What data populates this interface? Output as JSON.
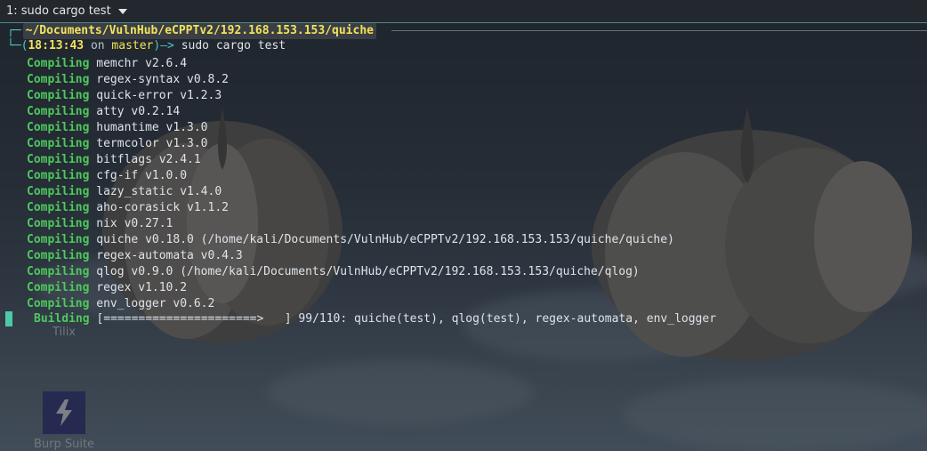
{
  "window": {
    "tab_title": "1: sudo cargo test"
  },
  "desktop": {
    "icons": [
      {
        "name": "Tilix"
      },
      {
        "name": "Burp Suite"
      }
    ]
  },
  "terminal": {
    "cwd": "~/Documents/VulnHub/eCPPTv2/192.168.153.153/quiche",
    "time": "18:13:43",
    "on_word": "on",
    "branch": "master",
    "arrow": "—>",
    "command": "sudo cargo test",
    "compile_keyword": "Compiling",
    "compiled": [
      "memchr v2.6.4",
      "regex-syntax v0.8.2",
      "quick-error v1.2.3",
      "atty v0.2.14",
      "humantime v1.3.0",
      "termcolor v1.3.0",
      "bitflags v2.4.1",
      "cfg-if v1.0.0",
      "lazy_static v1.4.0",
      "aho-corasick v1.1.2",
      "nix v0.27.1",
      "quiche v0.18.0 (/home/kali/Documents/VulnHub/eCPPTv2/192.168.153.153/quiche/quiche)",
      "regex-automata v0.4.3",
      "qlog v0.9.0 (/home/kali/Documents/VulnHub/eCPPTv2/192.168.153.153/quiche/qlog)",
      "regex v1.10.2",
      "env_logger v0.6.2"
    ],
    "build_keyword": "Building",
    "build_status": "[======================>   ] 99/110: quiche(test), qlog(test), regex-automata, env_logger"
  }
}
